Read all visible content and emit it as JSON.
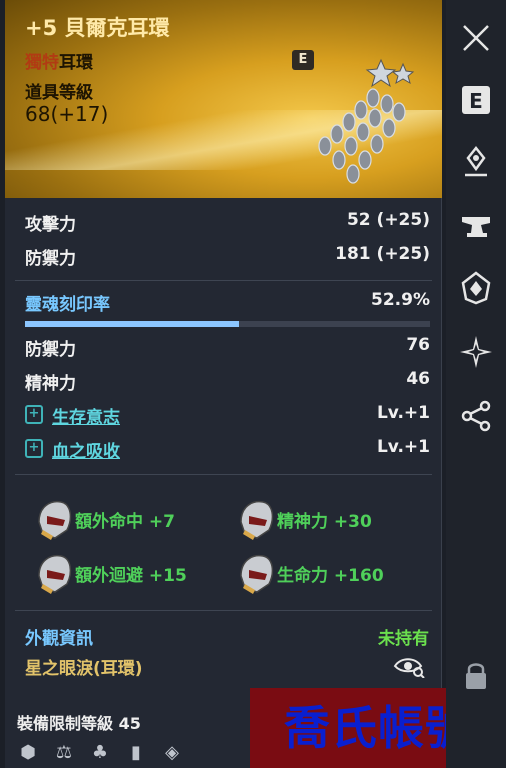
{
  "item": {
    "name": "+5 貝爾克耳環",
    "rarity_prefix": "獨特",
    "rarity_suffix": "耳環",
    "level_label": "道具等級",
    "level_value": "68(+17)",
    "badge": "E"
  },
  "stats": [
    {
      "label": "攻擊力",
      "value": "52 (+25)"
    },
    {
      "label": "防禦力",
      "value": "181 (+25)"
    }
  ],
  "soul": {
    "label": "靈魂刻印率",
    "value": "52.9%",
    "fraction": 0.529
  },
  "stats2": [
    {
      "label": "防禦力",
      "value": "76"
    },
    {
      "label": "精神力",
      "value": "46"
    }
  ],
  "skills": [
    {
      "label": "生存意志",
      "value": "Lv.+1"
    },
    {
      "label": "血之吸收",
      "value": "Lv.+1"
    }
  ],
  "bonuses": [
    {
      "text": "額外命中 +7"
    },
    {
      "text": "精神力 +30"
    },
    {
      "text": "額外迴避 +15"
    },
    {
      "text": "生命力 +160"
    }
  ],
  "appearance": {
    "label": "外觀資訊",
    "status": "未持有",
    "name": "星之眼淚(耳環)"
  },
  "requirement": {
    "text": "裝備限制等級 45"
  },
  "watermark": {
    "text": "喬氏帳號"
  },
  "sidebar": {
    "badge": "E"
  },
  "colors": {
    "header": "#d79f1f",
    "accent_blue": "#78c8ff",
    "bonus_green": "#4fd05a",
    "watermark_bg": "#7a0c12"
  }
}
